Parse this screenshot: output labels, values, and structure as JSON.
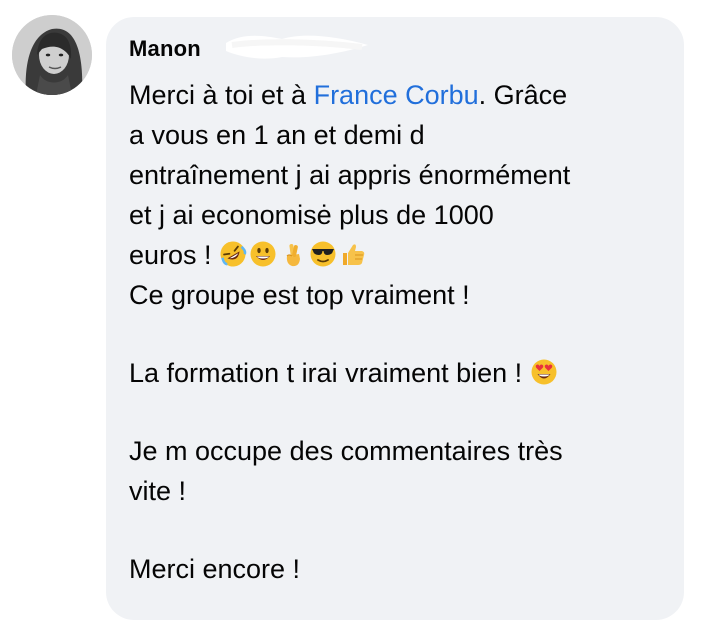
{
  "comment": {
    "author_name": "Manon",
    "line1_before": "Merci à toi et à ",
    "mention": "France Corbu",
    "line1_after": ". Grâce",
    "line2": "a vous en 1 an et demi d",
    "line3": "entraînement j ai appris énormément",
    "line4": "et j ai economisė plus de 1000",
    "line5": "euros ! ",
    "line6": "Ce groupe est top vraiment !",
    "line7": "La formation t irai vraiment bien ! ",
    "line8": "Je m occupe des commentaires très",
    "line9": "vite !",
    "line10": "Merci encore !"
  },
  "emojis": {
    "line5": [
      "rolling-laughing-emoji",
      "grinning-face-emoji",
      "crossed-fingers-emoji",
      "sunglasses-face-emoji",
      "thumbs-up-emoji"
    ],
    "line7": [
      "heart-eyes-emoji"
    ]
  },
  "colors": {
    "bubble_background": "#f0f2f5",
    "mention": "#216fdb",
    "text": "#050505"
  }
}
